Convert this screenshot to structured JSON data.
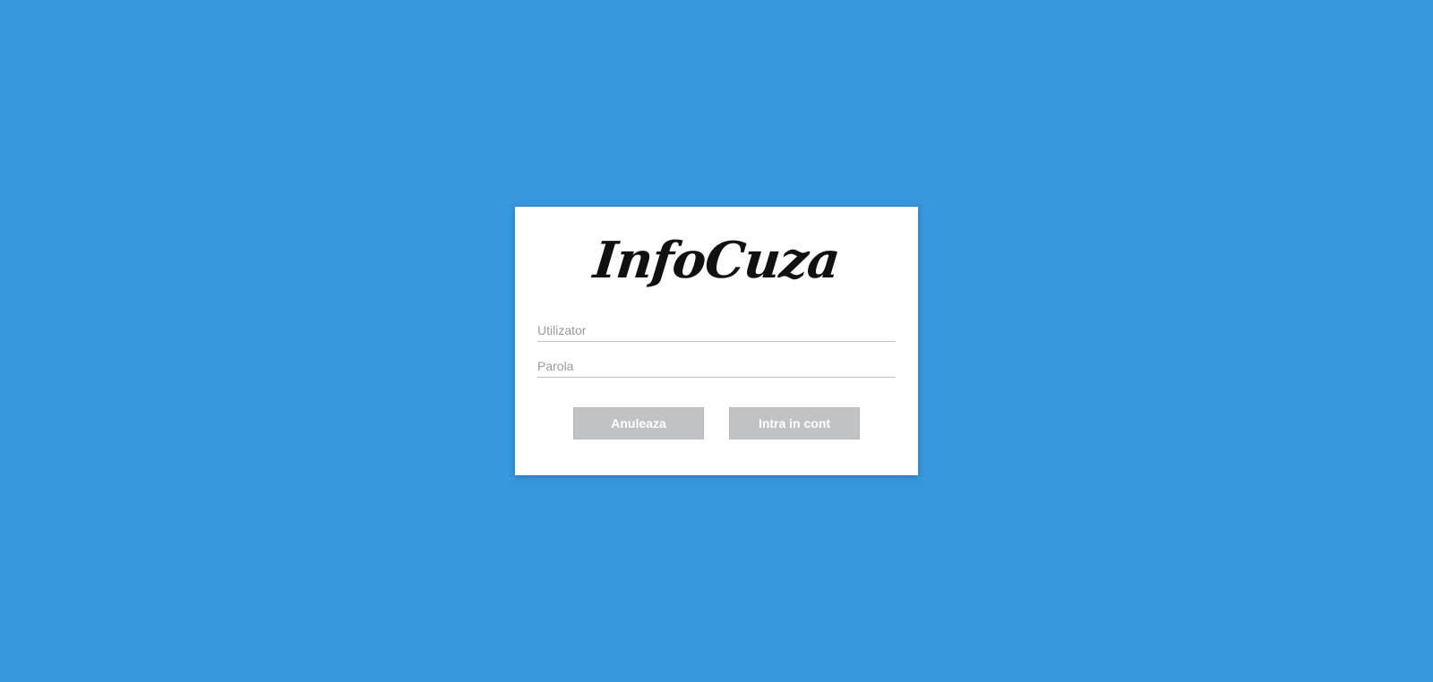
{
  "login": {
    "logo_text": "InfoCuza",
    "username": {
      "placeholder": "Utilizator",
      "value": ""
    },
    "password": {
      "placeholder": "Parola",
      "value": ""
    },
    "cancel_label": "Anuleaza",
    "submit_label": "Intra in cont"
  },
  "colors": {
    "background": "#3797dc",
    "card": "#ffffff",
    "button": "#bfc3c6",
    "button_text": "#ffffff",
    "logo": "#111111"
  }
}
